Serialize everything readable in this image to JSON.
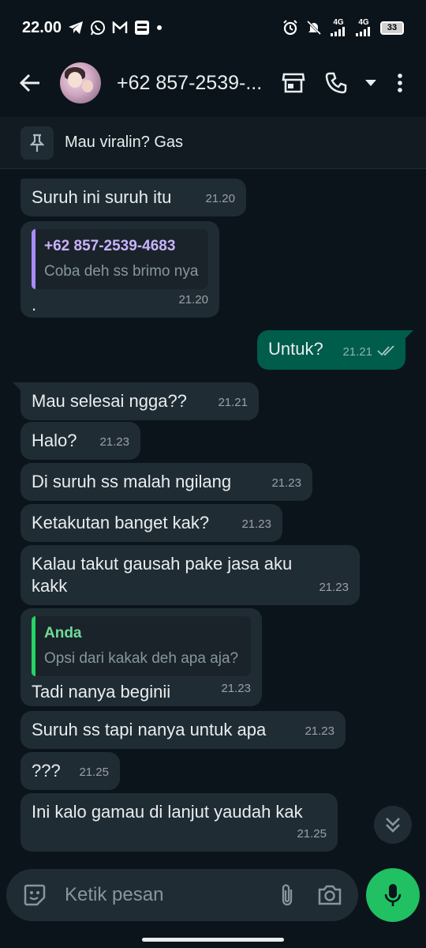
{
  "status_bar": {
    "time": "22.00",
    "net1": "4G",
    "net2": "4G",
    "battery": "33",
    "left_icons": [
      "telegram-icon",
      "whatsapp-icon",
      "gmail-icon",
      "brimo-icon",
      "dot-icon"
    ],
    "right_icons": [
      "alarm-icon",
      "mute-icon",
      "signal-icon",
      "signal-icon",
      "battery-icon"
    ]
  },
  "header": {
    "contact_name": "+62 857-2539-...",
    "icons": [
      "back-arrow-icon",
      "store-icon",
      "phone-icon",
      "caret-down-icon",
      "more-vert-icon"
    ]
  },
  "pinned": {
    "text": "Mau viralin? Gas",
    "icon": "pin-icon"
  },
  "messages": [
    {
      "dir": "in",
      "text": "Suruh ini suruh itu",
      "time": "21.20"
    },
    {
      "dir": "in",
      "reply": {
        "author": "+62 857-2539-4683",
        "text": "Coba deh ss brimo nya"
      },
      "text": ".",
      "time": "21.20"
    },
    {
      "dir": "out",
      "text": "Untuk?",
      "time": "21.21",
      "status": "read-double-check-icon"
    },
    {
      "dir": "in",
      "text": "Mau selesai ngga??",
      "time": "21.21"
    },
    {
      "dir": "in",
      "text": "Halo?",
      "time": "21.23"
    },
    {
      "dir": "in",
      "text": "Di suruh ss malah ngilang",
      "time": "21.23"
    },
    {
      "dir": "in",
      "text": "Ketakutan banget kak?",
      "time": "21.23"
    },
    {
      "dir": "in",
      "text": "Kalau takut gausah pake jasa aku kakk",
      "time": "21.23"
    },
    {
      "dir": "in",
      "reply": {
        "author": "Anda",
        "text": "Opsi dari kakak deh apa aja?"
      },
      "text": "Tadi nanya beginii",
      "time": "21.23"
    },
    {
      "dir": "in",
      "text": "Suruh ss tapi nanya untuk apa",
      "time": "21.23"
    },
    {
      "dir": "in",
      "text": "???",
      "time": "21.25"
    },
    {
      "dir": "in",
      "text": "Ini kalo gamau di lanjut yaudah kak",
      "time": "21.25"
    }
  ],
  "composer": {
    "placeholder": "Ketik pesan",
    "icons": [
      "sticker-icon",
      "attach-icon",
      "camera-icon",
      "mic-icon",
      "scroll-down-icon"
    ]
  },
  "colors": {
    "background": "#0b141a",
    "incoming_bubble": "#202c33",
    "outgoing_bubble": "#005c4b",
    "accent_green": "#21c063"
  }
}
